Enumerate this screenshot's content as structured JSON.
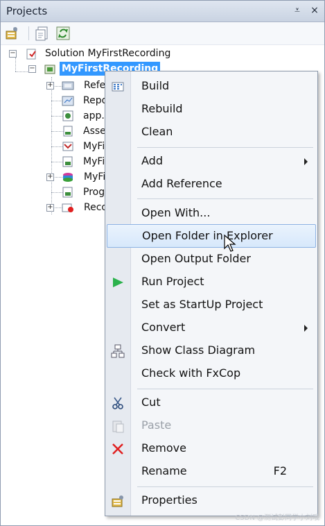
{
  "panel": {
    "title": "Projects",
    "pin_glyph": "⩡",
    "close_glyph": "×"
  },
  "toolbar": {
    "buttons": [
      {
        "icon": "properties-icon"
      },
      {
        "icon": "show-all-files-icon"
      },
      {
        "icon": "refresh-icon"
      }
    ]
  },
  "tree": {
    "solution": "Solution MyFirstRecording",
    "project": "MyFirstRecording",
    "children": [
      {
        "label": "Refe",
        "icon": "references-icon",
        "expandable": true
      },
      {
        "label": "Repo",
        "icon": "report-icon",
        "expandable": false
      },
      {
        "label": "app.c",
        "icon": "config-file-icon",
        "expandable": false
      },
      {
        "label": "Asse",
        "icon": "assembly-info-icon",
        "expandable": false
      },
      {
        "label": "MyFi",
        "icon": "recording-file-icon",
        "expandable": false
      },
      {
        "label": "MyFi",
        "icon": "code-file-icon",
        "expandable": false
      },
      {
        "label": "MyFi",
        "icon": "repository-icon",
        "expandable": true
      },
      {
        "label": "Prog",
        "icon": "code-file-icon",
        "expandable": false
      },
      {
        "label": "Reco",
        "icon": "recordings-folder-icon",
        "expandable": true
      }
    ]
  },
  "menu": {
    "items": [
      {
        "label": "Build",
        "icon": "build-icon"
      },
      {
        "label": "Rebuild"
      },
      {
        "label": "Clean"
      },
      {
        "label": "Add",
        "submenu": true
      },
      {
        "label": "Add Reference"
      },
      {
        "label": "Open With..."
      },
      {
        "label": "Open Folder in Explorer",
        "highlighted": true
      },
      {
        "label": "Open Output Folder"
      },
      {
        "label": "Run Project",
        "icon": "run-icon"
      },
      {
        "label": "Set as StartUp Project"
      },
      {
        "label": "Convert",
        "submenu": true
      },
      {
        "label": "Show Class Diagram",
        "icon": "class-diagram-icon"
      },
      {
        "label": "Check with FxCop"
      },
      {
        "label": "Cut",
        "icon": "cut-icon"
      },
      {
        "label": "Paste",
        "icon": "paste-icon",
        "disabled": true
      },
      {
        "label": "Remove",
        "icon": "remove-icon"
      },
      {
        "label": "Rename",
        "shortcut": "F2"
      },
      {
        "label": "Properties",
        "icon": "properties-icon"
      }
    ]
  },
  "watermark": "CSDN @测试彭同学小刘哦",
  "colors": {
    "selection": "#3398ff",
    "menu_hover": "#d7e8fb",
    "run_green": "#2bb24c",
    "remove_red": "#e02020"
  }
}
